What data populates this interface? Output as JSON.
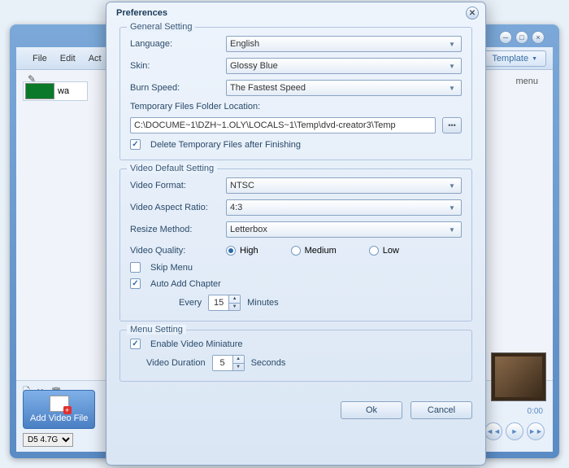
{
  "bg": {
    "menubar": [
      "File",
      "Edit",
      "Act"
    ],
    "template_btn": "Template",
    "menu_txt": "menu",
    "thumb_label": "wa",
    "add_video": "Add Video File",
    "disc": "D5  4.7G",
    "time": "0:00"
  },
  "dialog": {
    "title": "Preferences",
    "general": {
      "legend": "General Setting",
      "language_lbl": "Language:",
      "language_val": "English",
      "skin_lbl": "Skin:",
      "skin_val": "Glossy Blue",
      "burn_lbl": "Burn Speed:",
      "burn_val": "The Fastest Speed",
      "temp_lbl": "Temporary Files Folder Location:",
      "temp_val": "C:\\DOCUME~1\\DZH~1.OLY\\LOCALS~1\\Temp\\dvd-creator3\\Temp",
      "delete_lbl": "Delete Temporary Files after Finishing"
    },
    "video": {
      "legend": "Video Default Setting",
      "format_lbl": "Video Format:",
      "format_val": "NTSC",
      "aspect_lbl": "Video Aspect Ratio:",
      "aspect_val": "4:3",
      "resize_lbl": "Resize Method:",
      "resize_val": "Letterbox",
      "quality_lbl": "Video Quality:",
      "q_high": "High",
      "q_med": "Medium",
      "q_low": "Low",
      "skip_lbl": "Skip Menu",
      "auto_lbl": "Auto Add Chapter",
      "every_lbl": "Every",
      "every_val": "15",
      "every_unit": "Minutes"
    },
    "menu": {
      "legend": "Menu Setting",
      "enable_lbl": "Enable Video Miniature",
      "duration_lbl": "Video Duration",
      "duration_val": "5",
      "duration_unit": "Seconds"
    },
    "ok": "Ok",
    "cancel": "Cancel"
  }
}
